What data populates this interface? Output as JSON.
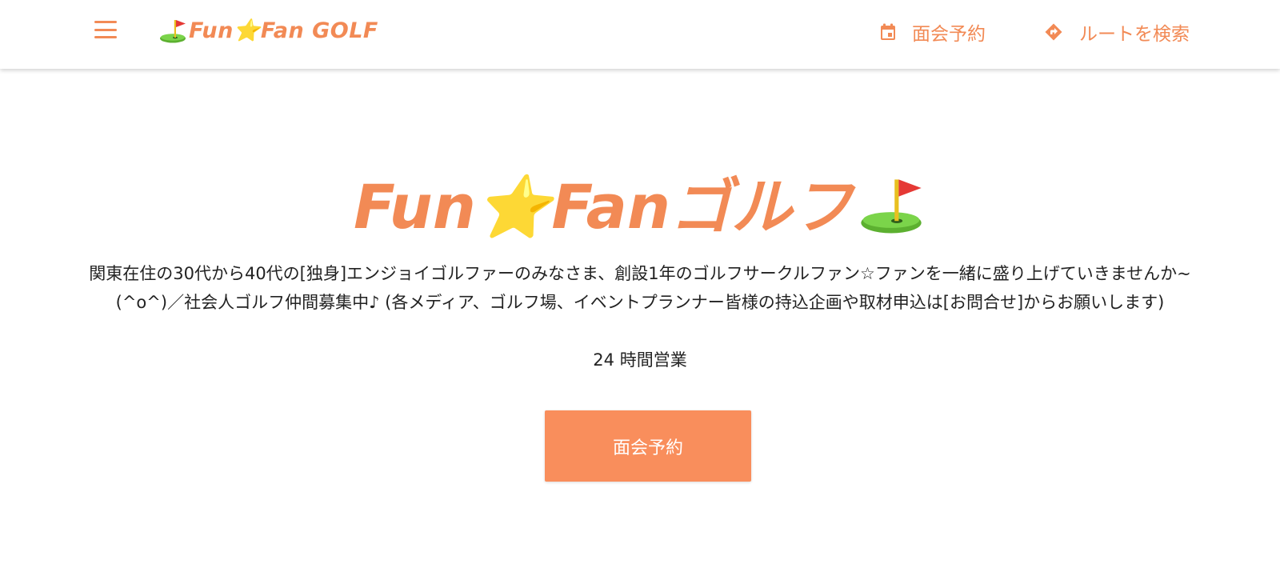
{
  "header": {
    "logo": {
      "text": "Fun⭐Fan GOLF",
      "icon": "golf-flag-icon"
    },
    "menu_icon": "hamburger-menu-icon",
    "nav": [
      {
        "label": "面会予約",
        "icon": "calendar-icon"
      },
      {
        "label": "ルートを検索",
        "icon": "directions-icon"
      }
    ]
  },
  "hero": {
    "title": "Fun⭐Fanゴルフ",
    "title_icon": "golf-flag-icon",
    "description": "関東在住の30代から40代の[独身]エンジョイゴルファーのみなさま、創設1年のゴルフサークルファン☆ファンを一緒に盛り上げていきませんか~(^o^)／社会人ゴルフ仲間募集中♪ (各メディア、ゴルフ場、イベントプランナー皆様の持込企画や取材申込は[お問合せ]からお願いします)",
    "hours": "24 時間営業",
    "cta_label": "面会予約"
  },
  "colors": {
    "accent": "#f28a55",
    "button": "#f98e5c",
    "text": "#222222",
    "background": "#ffffff"
  }
}
